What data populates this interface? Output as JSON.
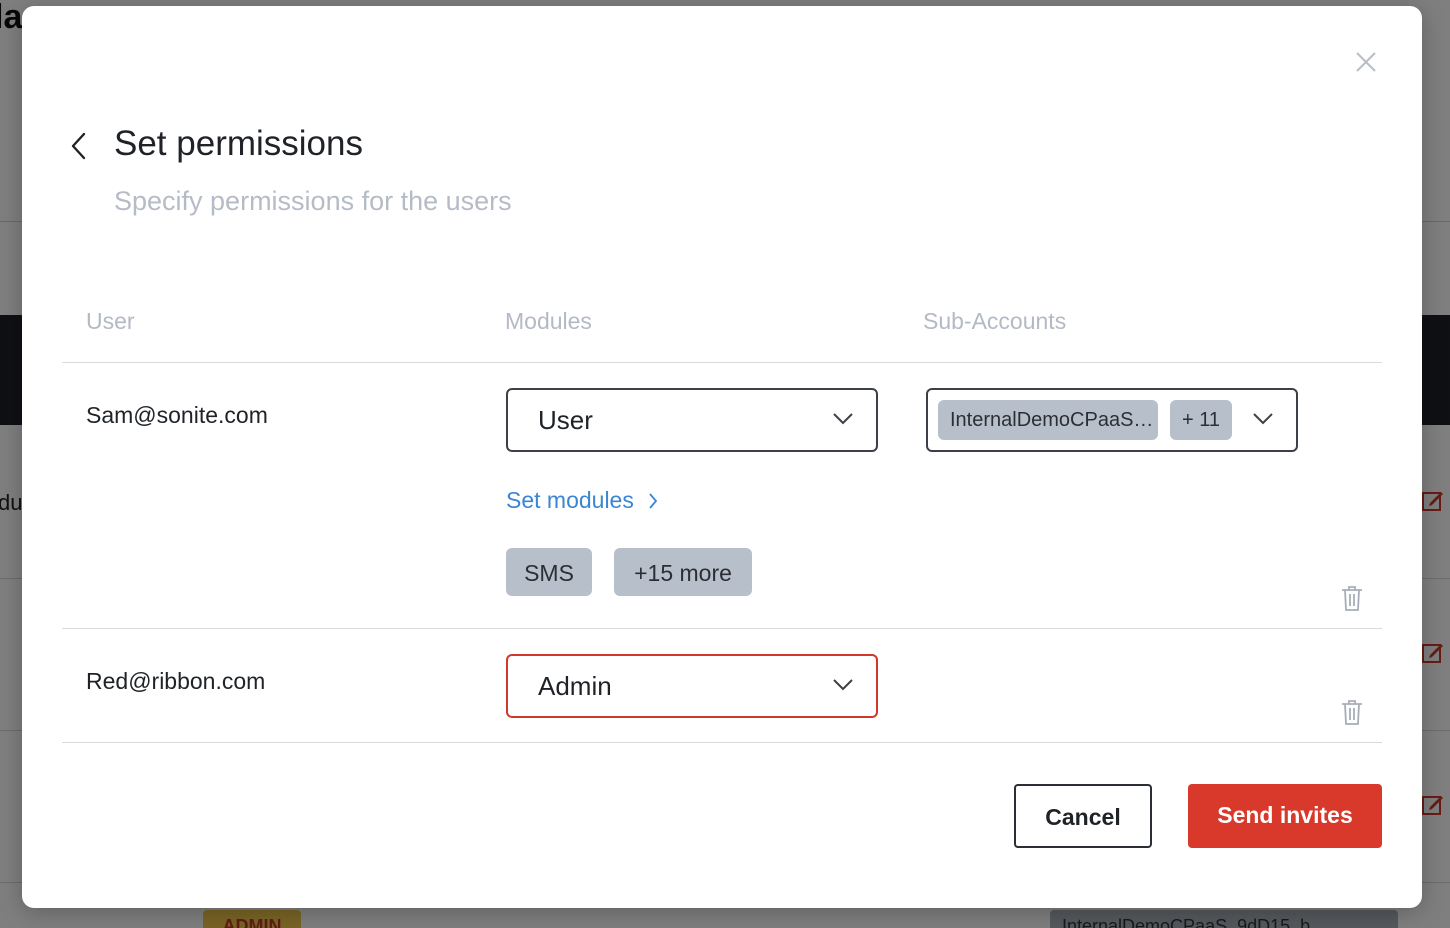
{
  "background": {
    "title_fragment": "la",
    "side_text_fragment": "du",
    "badge_fragment": "ADMIN",
    "chip_fragment": "InternalDemoCPaaS_9dD15_b"
  },
  "modal": {
    "title": "Set permissions",
    "subtitle": "Specify permissions for the users",
    "columns": {
      "user": "User",
      "modules": "Modules",
      "sub_accounts": "Sub-Accounts"
    },
    "rows": [
      {
        "email": "Sam@sonite.com",
        "module_role": "User",
        "sub_account_tag": "InternalDemoCPaaS…",
        "sub_account_more": "+ 11",
        "set_modules_label": "Set modules",
        "module_chips": [
          "SMS",
          "+15 more"
        ]
      },
      {
        "email": "Red@ribbon.com",
        "module_role": "Admin"
      }
    ],
    "buttons": {
      "cancel": "Cancel",
      "send": "Send invites"
    }
  },
  "colors": {
    "accent": "#d9392b",
    "link": "#3a86d4",
    "error_border": "#d0382b"
  }
}
